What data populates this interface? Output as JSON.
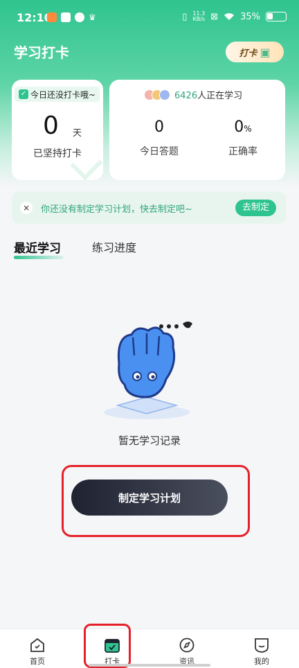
{
  "status_bar": {
    "time": "12:10",
    "net_speed_value": "11.3",
    "net_speed_unit": "KB/s",
    "battery": "35%",
    "battery_level": 0.35
  },
  "header": {
    "title": "学习打卡",
    "badge_label": "打卡"
  },
  "stats_left": {
    "tag": "今日还没打卡哦~",
    "days": "0",
    "days_unit": "天",
    "label": "已坚持打卡"
  },
  "stats_right": {
    "learner_count": "6426",
    "learner_suffix": "人正在学习",
    "today_answers": "0",
    "today_answers_label": "今日答题",
    "accuracy": "0",
    "accuracy_unit": "%",
    "accuracy_label": "正确率"
  },
  "plan_banner": {
    "close": "×",
    "text": "你还没有制定学习计划，快去制定吧~",
    "button": "去制定"
  },
  "tabs": [
    {
      "label": "最近学习"
    },
    {
      "label": "练习进度"
    }
  ],
  "empty_state": {
    "text": "暂无学习记录",
    "button": "制定学习计划"
  },
  "bottom_nav": [
    {
      "label": "首页",
      "icon": "home-icon"
    },
    {
      "label": "打卡",
      "icon": "calendar-check-icon"
    },
    {
      "label": "资讯",
      "icon": "compass-icon"
    },
    {
      "label": "我的",
      "icon": "profile-icon"
    }
  ],
  "colors": {
    "accent": "#2fc48f",
    "highlight": "#e5202a",
    "button_dark": "#1f2230"
  }
}
